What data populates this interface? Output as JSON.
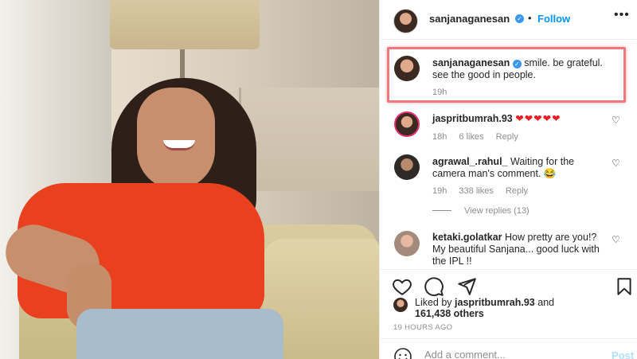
{
  "post": {
    "author": "sanjanaganesan",
    "follow_label": "Follow",
    "dot": "•",
    "more_icon": "more-horizontal-icon"
  },
  "caption": {
    "username": "sanjanaganesan",
    "text": "smile. be grateful. see the good in people.",
    "time": "19h"
  },
  "comments": [
    {
      "username": "jaspritbumrah.93",
      "text": "❤❤❤❤❤",
      "time": "18h",
      "likes": "6 likes",
      "reply": "Reply"
    },
    {
      "username": "agrawal_.rahul_",
      "text": "Waiting for the camera man's comment. 😂",
      "time": "19h",
      "likes": "338 likes",
      "reply": "Reply",
      "view_replies": "View replies (13)"
    },
    {
      "username": "ketaki.golatkar",
      "text": "How pretty are you!? My beautiful Sanjana... good luck with the IPL !!"
    }
  ],
  "likes_summary": {
    "prefix": "Liked by ",
    "liker": "jaspritbumrah.93",
    "and": " and",
    "others": "161,438 others"
  },
  "timestamp": "19 HOURS AGO",
  "add_comment": {
    "placeholder": "Add a comment...",
    "post_label": "Post"
  },
  "colors": {
    "accent": "#0095f6",
    "highlight_border": "#f2787e",
    "hearts": "#ed1c24",
    "verified": "#3897f0"
  }
}
